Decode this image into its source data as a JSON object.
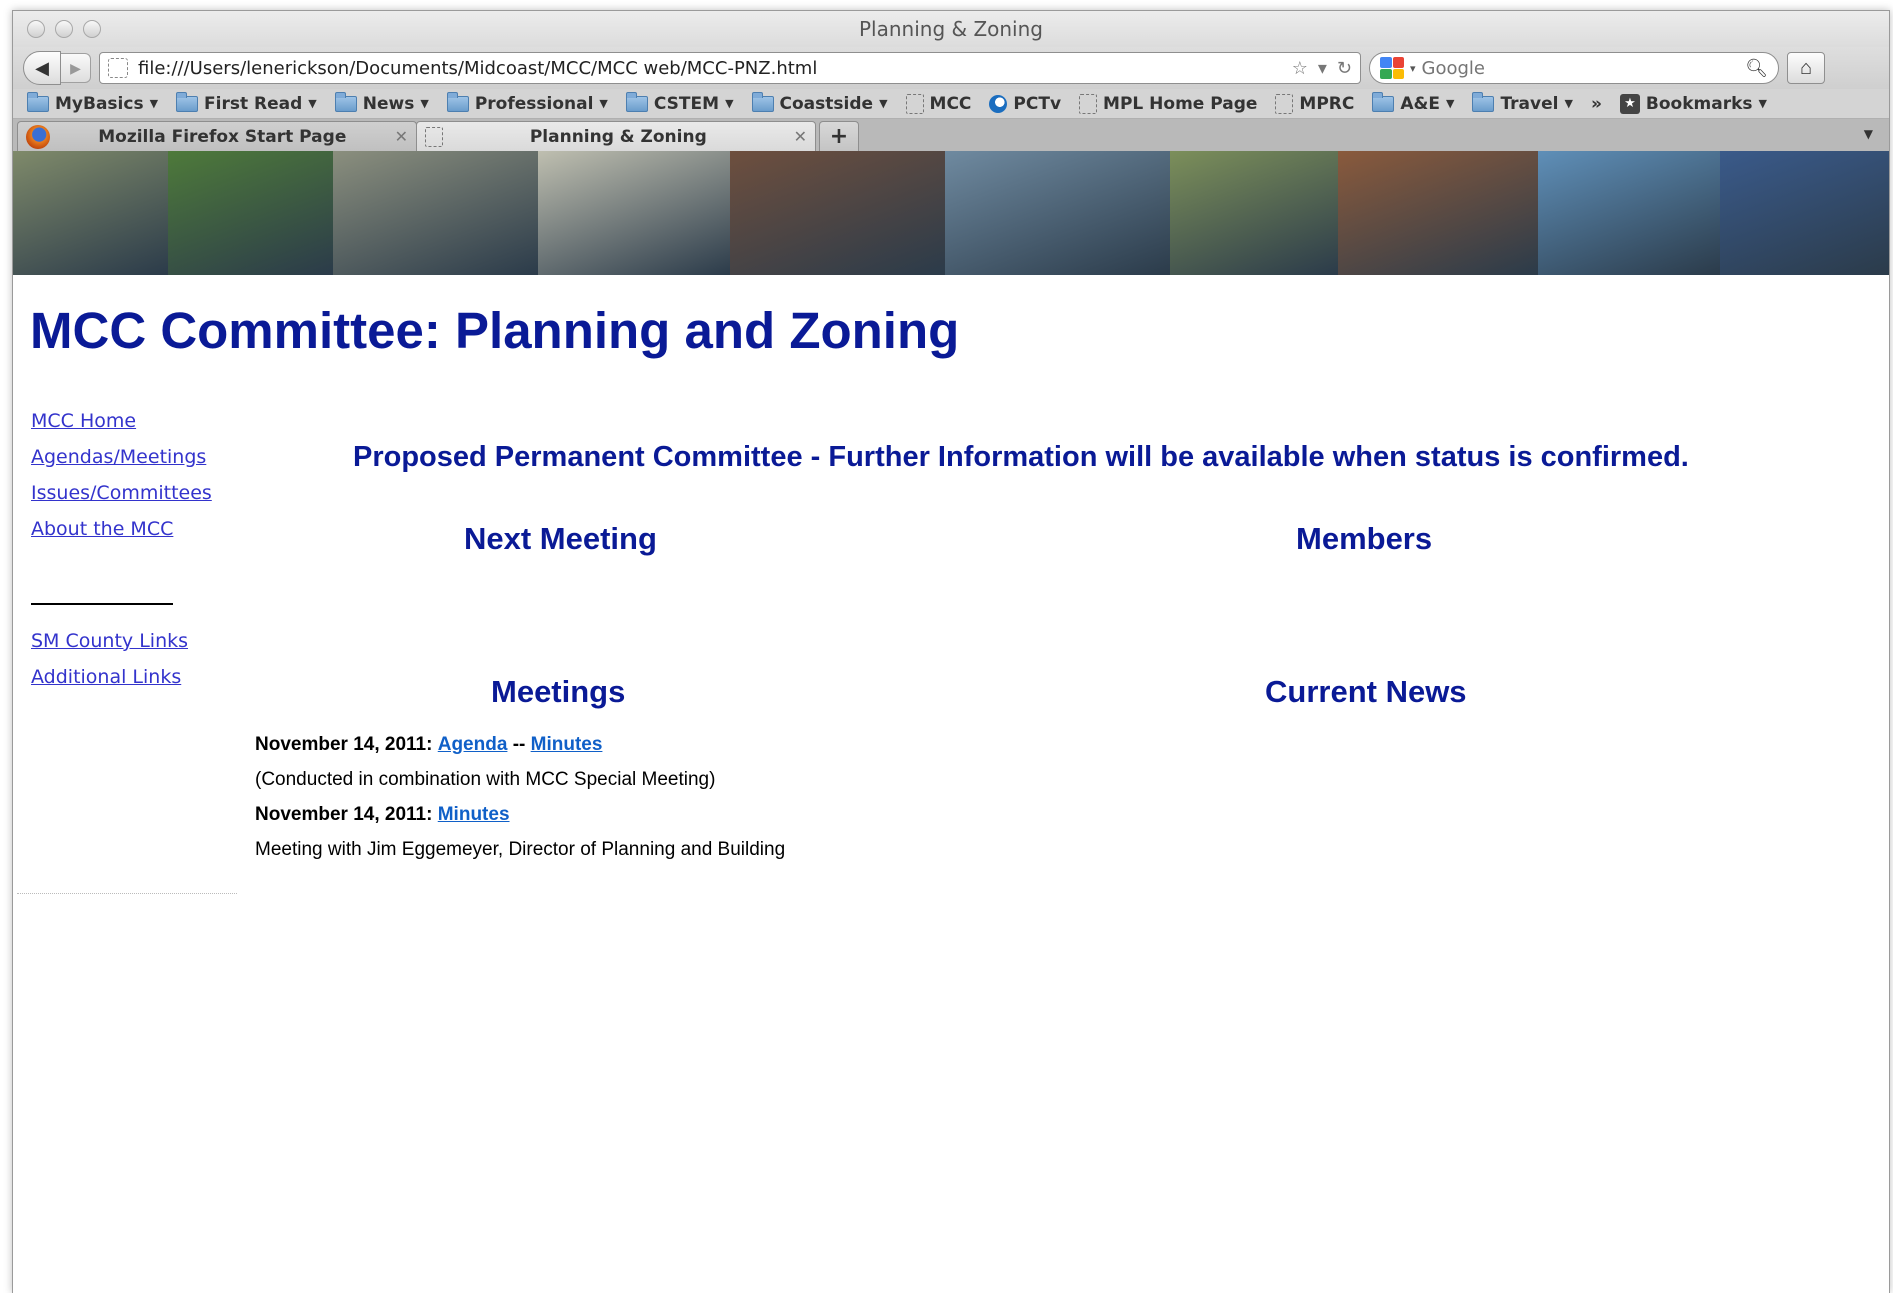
{
  "window": {
    "title": "Planning & Zoning"
  },
  "navbar": {
    "url": "file:///Users/lenerickson/Documents/Midcoast/MCC/MCC web/MCC-PNZ.html",
    "search_placeholder": "Google"
  },
  "bookmarks": [
    {
      "label": "MyBasics",
      "type": "folder"
    },
    {
      "label": "First Read",
      "type": "folder"
    },
    {
      "label": "News",
      "type": "folder"
    },
    {
      "label": "Professional",
      "type": "folder"
    },
    {
      "label": "CSTEM",
      "type": "folder"
    },
    {
      "label": "Coastside",
      "type": "folder"
    },
    {
      "label": "MCC",
      "type": "page"
    },
    {
      "label": "PCTv",
      "type": "pctv"
    },
    {
      "label": "MPL Home Page",
      "type": "page"
    },
    {
      "label": "MPRC",
      "type": "page"
    },
    {
      "label": "A&E",
      "type": "folder"
    },
    {
      "label": "Travel",
      "type": "folder"
    }
  ],
  "bookmarks_overflow": "»",
  "bookmarks_menu": "Bookmarks",
  "tabs": [
    {
      "title": "Mozilla Firefox Start Page",
      "icon": "firefox-icon",
      "active": false
    },
    {
      "title": "Planning & Zoning",
      "icon": "blank-page-icon",
      "active": true
    }
  ],
  "banner_colors": [
    "#7f8a6a",
    "#4e7a3a",
    "#8b8f7e",
    "#bfbfb0",
    "#6e4f3e",
    "#6f8aa0",
    "#7c8f5a",
    "#8a5a3c",
    "#5f8fb8",
    "#3a5a8a"
  ],
  "page": {
    "title": "MCC Committee: Planning and Zoning",
    "notice": "Proposed Permanent Committee - Further Information will be available when status is confirmed.",
    "next_meeting_heading": "Next Meeting",
    "members_heading": "Members",
    "meetings_heading": "Meetings",
    "current_news_heading": "Current News"
  },
  "sidebar": {
    "links": [
      "MCC Home",
      "Agendas/Meetings",
      "Issues/Committees",
      "About the MCC"
    ],
    "links2": [
      "SM County Links",
      "Additional Links"
    ]
  },
  "meetings": [
    {
      "date": "November 14, 2011:",
      "link1": "Agenda",
      "sep": "--",
      "link2": "Minutes",
      "note": "(Conducted in combination with MCC Special Meeting)"
    },
    {
      "date": "November 14, 2011:",
      "link1": "Minutes",
      "note": "Meeting with Jim Eggemeyer, Director of Planning and Building"
    }
  ]
}
